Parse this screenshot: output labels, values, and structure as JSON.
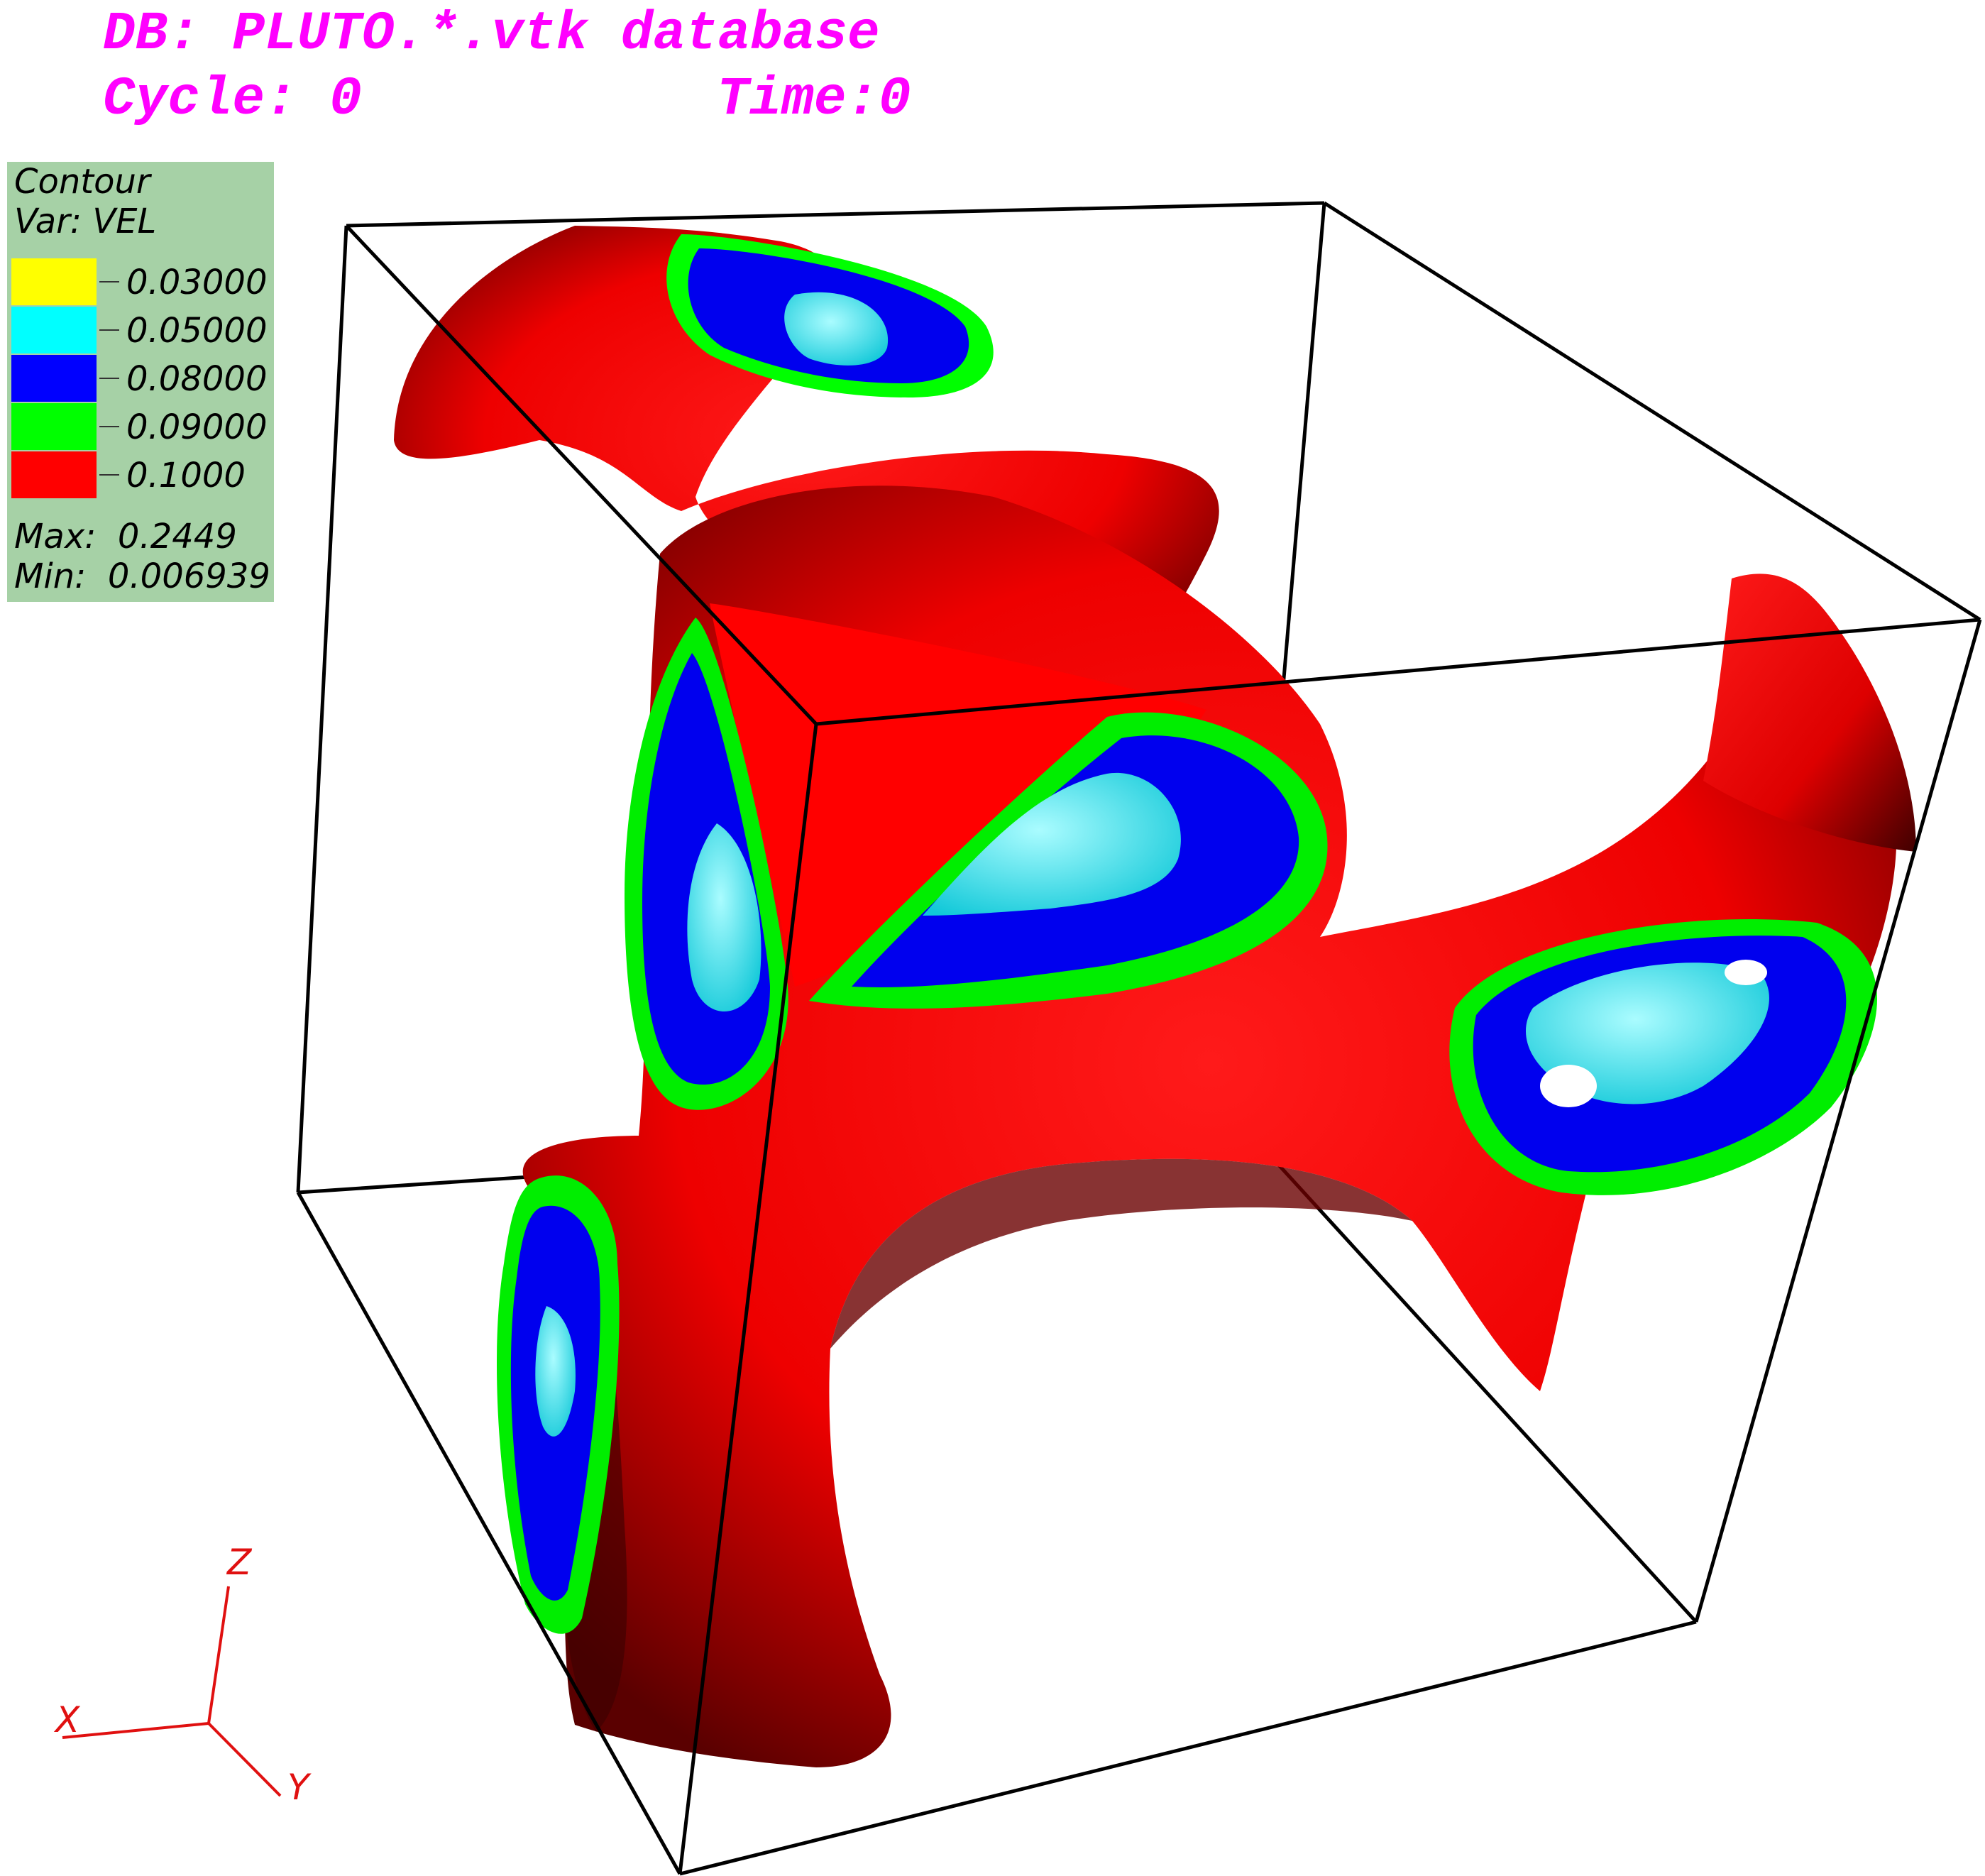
{
  "header": {
    "db_label": "DB: PLUTO.*.vtk database",
    "cycle_label": "Cycle: 0",
    "time_label": "Time:0"
  },
  "legend": {
    "title": "Contour",
    "var": "Var: VEL",
    "levels": [
      {
        "value": "0.03000",
        "color": "#ffff00"
      },
      {
        "value": "0.05000",
        "color": "#00ffff"
      },
      {
        "value": "0.08000",
        "color": "#0000ff"
      },
      {
        "value": "0.09000",
        "color": "#00ff00"
      },
      {
        "value": "0.1000",
        "color": "#ff0000"
      }
    ],
    "max": "Max:  0.2449",
    "min": "Min:  0.006939"
  },
  "axes": {
    "x": "X",
    "y": "Y",
    "z": "Z"
  },
  "colors": {
    "header": "#ff00ff",
    "axes": "#e01010",
    "box": "#000000"
  }
}
